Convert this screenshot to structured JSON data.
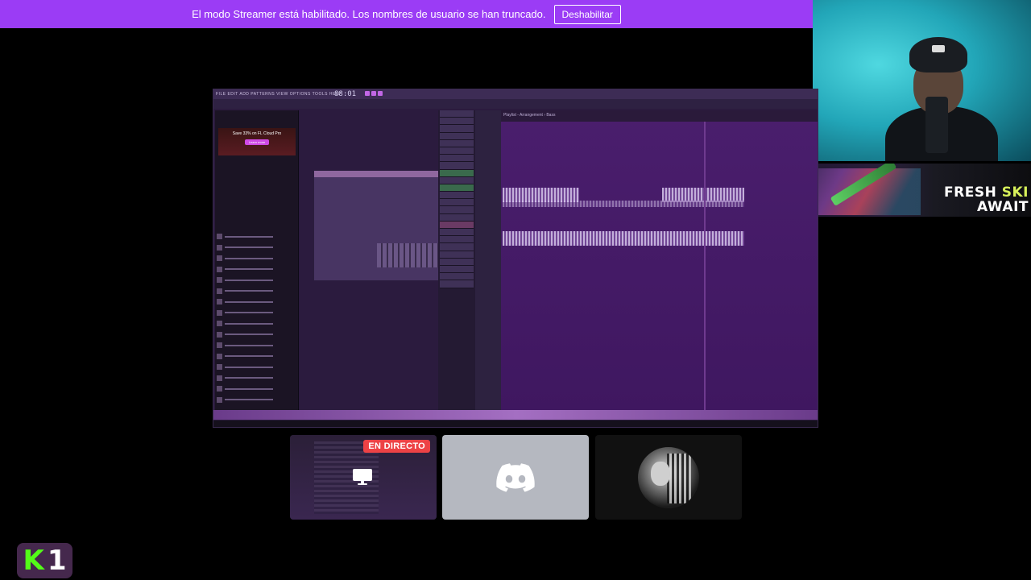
{
  "banner": {
    "message": "El modo Streamer está habilitado. Los nombres de usuario se han truncado.",
    "button_label": "Deshabilitar",
    "background_color": "#9b3cf5"
  },
  "ad": {
    "line1_word1": "FRESH",
    "line1_word2": "SKI",
    "line2": "AWAIT",
    "accent_color": "#d7f05a"
  },
  "shared_screen": {
    "app": "FL Studio",
    "time_display": "88:01",
    "menu": "FILE EDIT ADD PATTERNS VIEW OPTIONS TOOLS HELP",
    "playlist_title": "Playlist - Arrangement › Bass",
    "browser_ad": {
      "headline": "Save 33% on FL Cloud Pro",
      "button": "Learn more"
    }
  },
  "participants": [
    {
      "type": "screen-share",
      "badge": "EN DIRECTO",
      "badge_color": "#ed4245",
      "icon": "monitor-icon"
    },
    {
      "type": "discord-default",
      "icon": "discord-logo-icon",
      "background": "#b5b8c0"
    },
    {
      "type": "avatar",
      "icon": "avatar"
    }
  ],
  "logo": {
    "letter": "K",
    "number": "1",
    "letter_color": "#53fc18"
  }
}
